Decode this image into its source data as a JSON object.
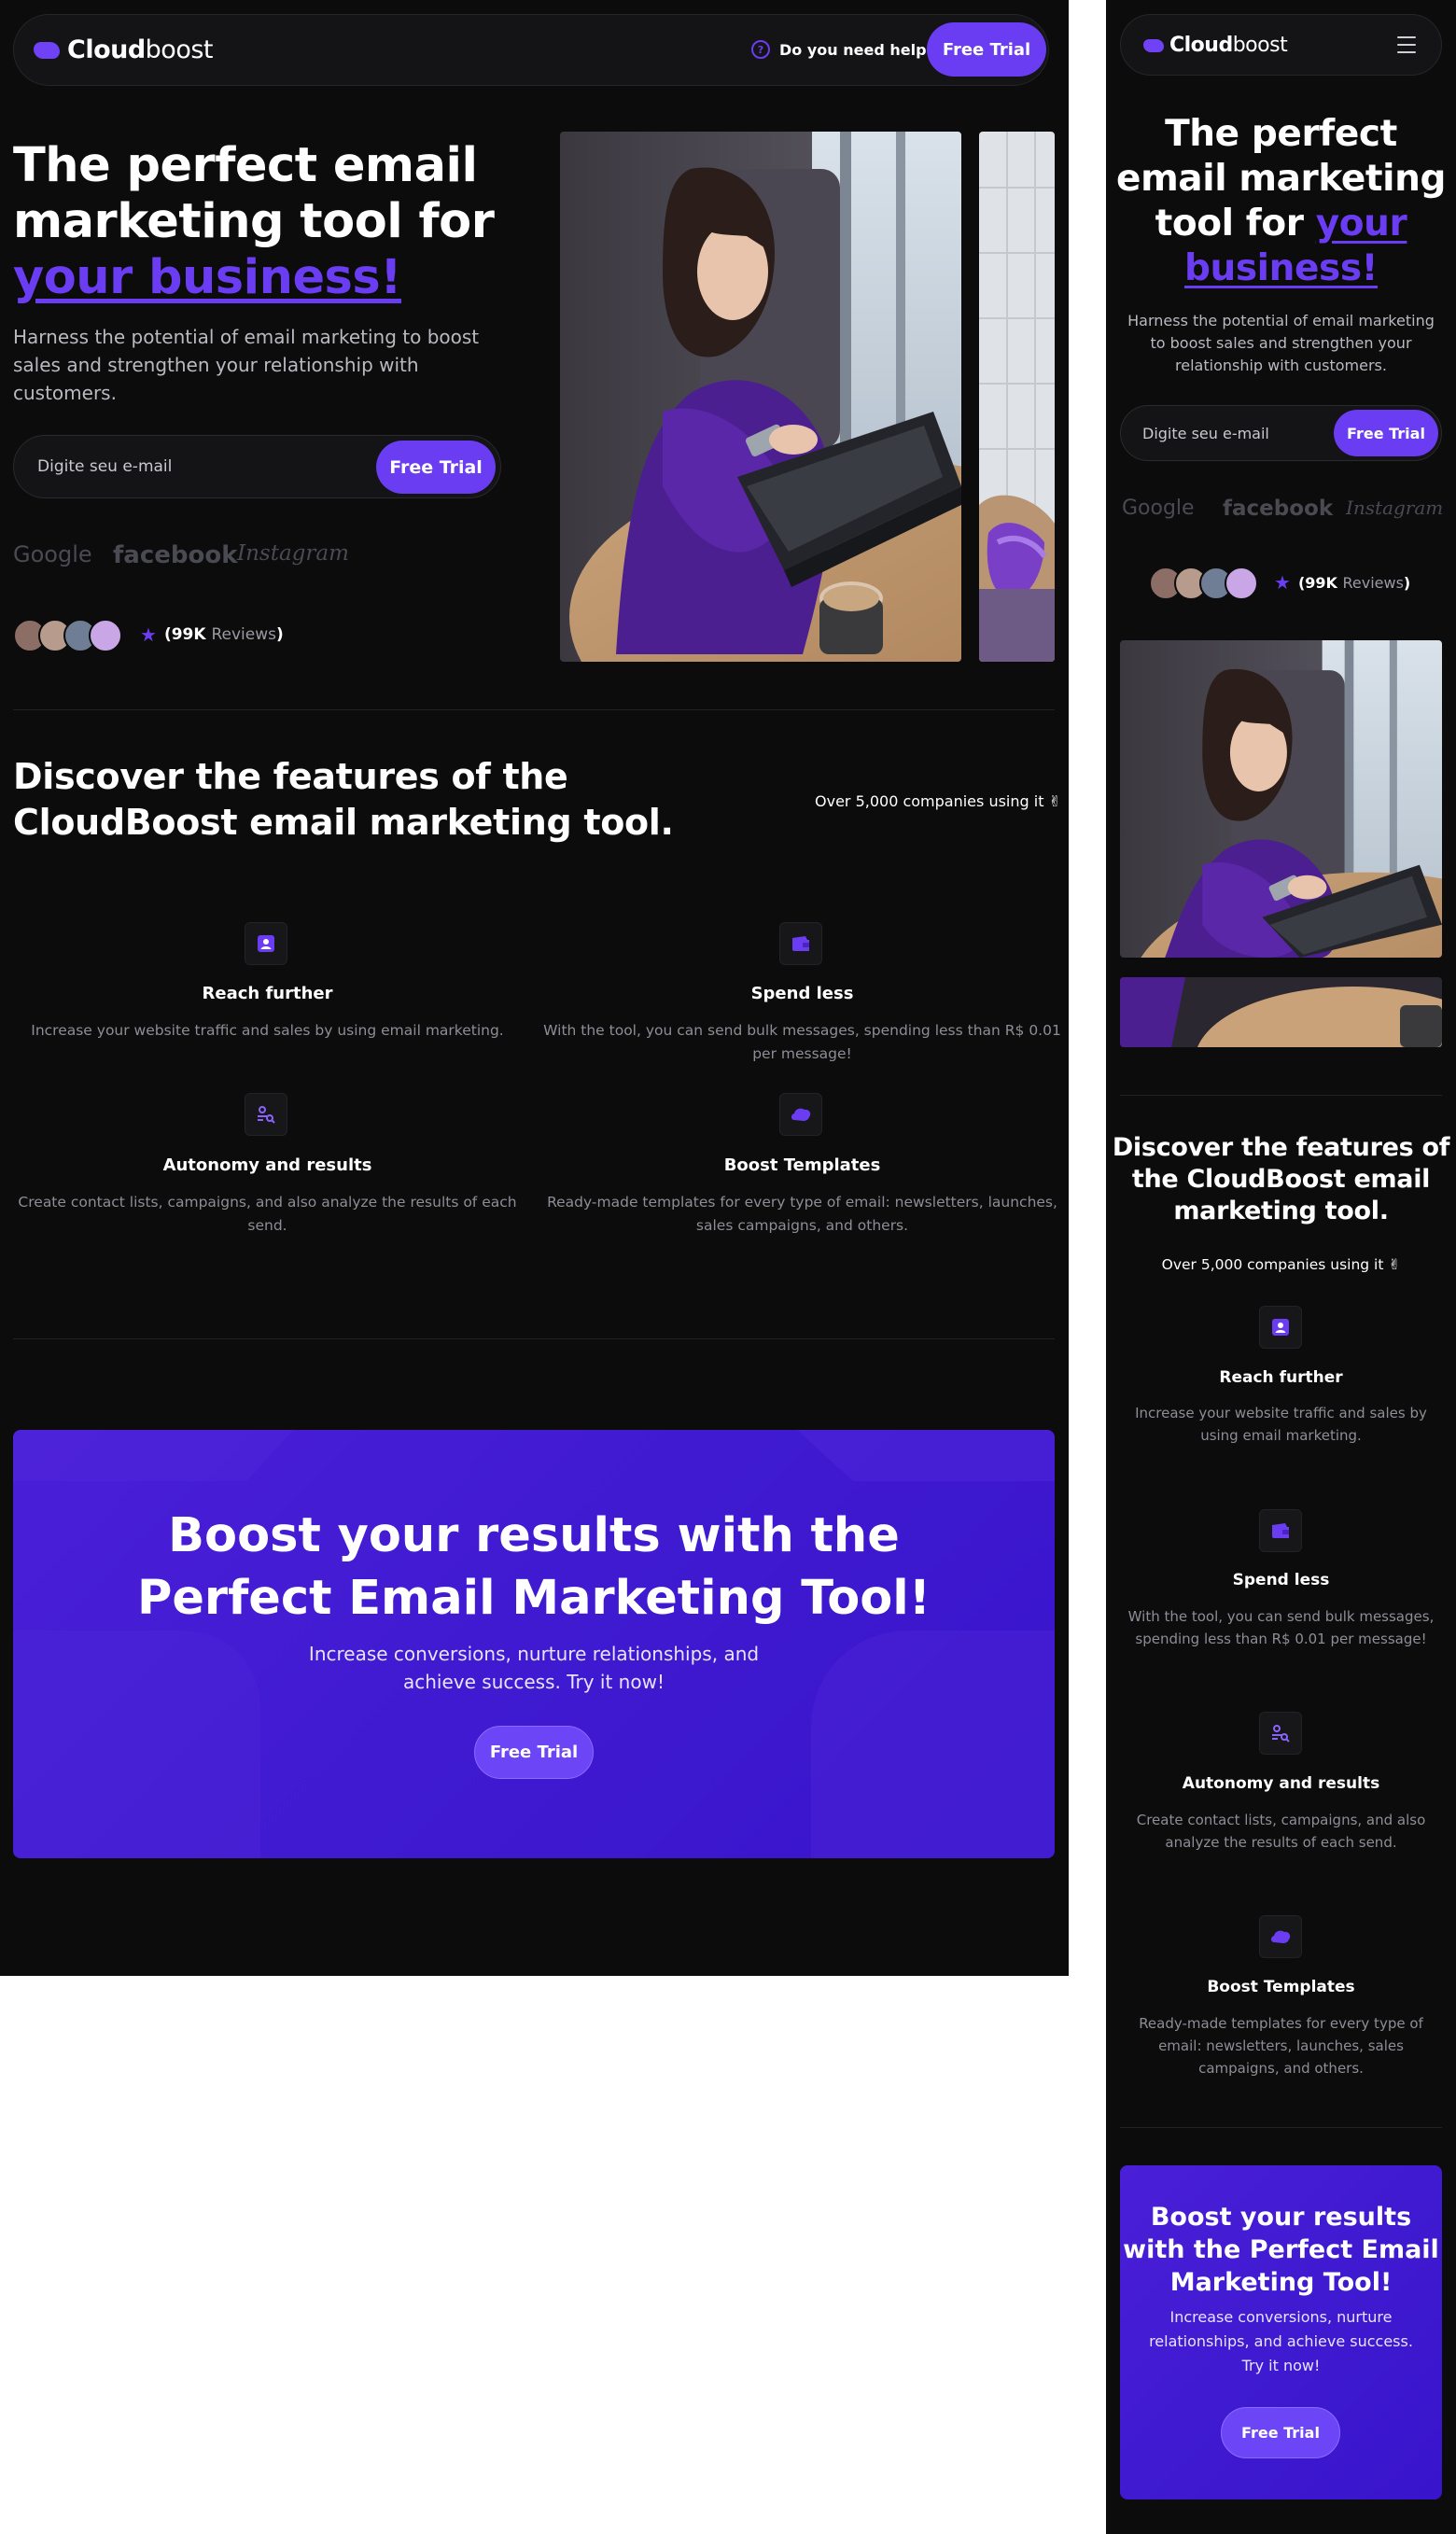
{
  "brand": {
    "name_bold": "Cloud",
    "name_light": "boost"
  },
  "nav": {
    "help_label": "Do you need help?",
    "trial_label": "Free Trial"
  },
  "hero": {
    "title_line1": "The perfect email",
    "title_line2": "marketing tool for",
    "title_highlight": "your business!",
    "mobile_title_line1": "The perfect",
    "mobile_title_line2": "email marketing",
    "mobile_title_line3": "tool for",
    "mobile_title_hl1": "your",
    "mobile_title_hl2": "business!",
    "subtitle_l1": "Harness the potential of email marketing to boost",
    "subtitle_l2": "sales and strengthen your relationship with",
    "subtitle_l3": "customers.",
    "m_sub_l1": "Harness the potential of email marketing",
    "m_sub_l2": "to boost sales and strengthen your",
    "m_sub_l3": "relationship with customers.",
    "email_placeholder": "Digite seu e-mail",
    "trial_label": "Free Trial"
  },
  "logos": [
    "Google",
    "facebook",
    "Instagram"
  ],
  "reviews": {
    "count": "(99K",
    "word": "Reviews",
    "close": ")"
  },
  "features": {
    "title_l1": "Discover the features of the",
    "title_l2": "CloudBoost email marketing tool.",
    "m_title_l1": "Discover the features of",
    "m_title_l2": "the CloudBoost email",
    "m_title_l3": "marketing tool.",
    "companies": "Over 5,000 companies using it ✌",
    "items": [
      {
        "title": "Reach further",
        "desc_l1": "Increase your website traffic and sales by using email marketing.",
        "desc_l2": "",
        "m_l1": "Increase your website traffic and sales by",
        "m_l2": "using email marketing.",
        "m_l3": "",
        "icon": "user-card-icon"
      },
      {
        "title": "Spend less",
        "desc_l1": "With the tool, you can send bulk messages, spending less than R$ 0.01",
        "desc_l2": "per message!",
        "m_l1": "With the tool, you can send bulk messages,",
        "m_l2": "spending less than R$ 0.01 per message!",
        "m_l3": "",
        "icon": "wallet-icon"
      },
      {
        "title": "Autonomy and results",
        "desc_l1": "Create contact lists, campaigns, and also analyze the results of each",
        "desc_l2": "send.",
        "m_l1": "Create contact lists, campaigns, and also",
        "m_l2": "analyze the results of each send.",
        "m_l3": "",
        "icon": "user-search-icon"
      },
      {
        "title": "Boost Templates",
        "desc_l1": "Ready-made templates for every type of email: newsletters, launches,",
        "desc_l2": "sales campaigns, and others.",
        "m_l1": "Ready-made templates for every type of",
        "m_l2": "email: newsletters, launches, sales",
        "m_l3": "campaigns, and others.",
        "icon": "cloud-icon"
      }
    ]
  },
  "cta": {
    "title_l1": "Boost your results with the",
    "title_l2": "Perfect Email Marketing Tool!",
    "m_title_l1": "Boost your results",
    "m_title_l2": "with the Perfect Email",
    "m_title_l3": "Marketing Tool!",
    "sub_l1": "Increase conversions, nurture relationships, and",
    "sub_l2": "achieve success. Try it now!",
    "m_sub_l1": "Increase conversions, nurture",
    "m_sub_l2": "relationships, and achieve success.",
    "m_sub_l3": "Try it now!",
    "button": "Free Trial"
  },
  "colors": {
    "accent": "#6a3cf2",
    "background": "#0c0c0d",
    "cta": "#3f1ad0"
  }
}
